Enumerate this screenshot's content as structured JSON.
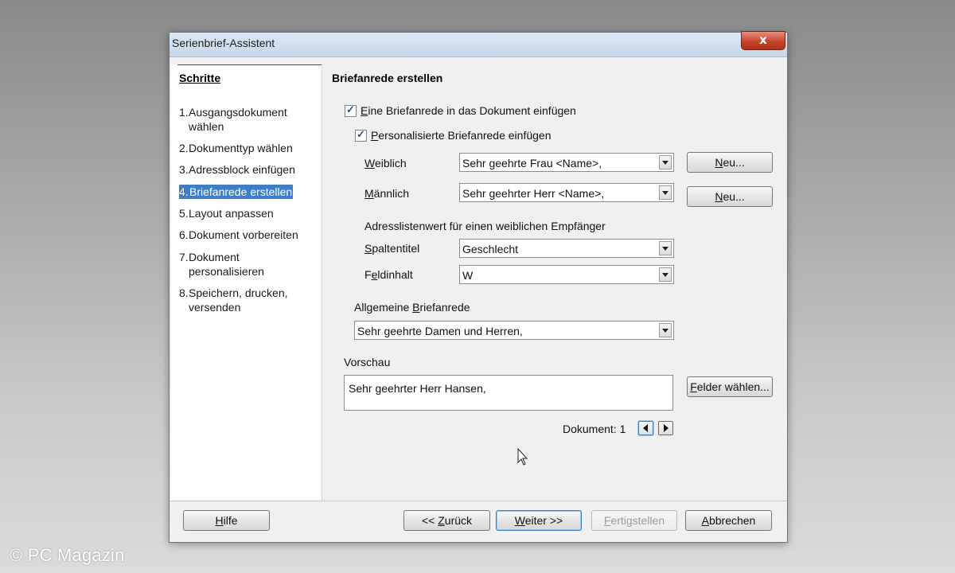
{
  "watermark": "© PC Magazin",
  "window": {
    "title": "Serienbrief-Assistent",
    "close_glyph": "x"
  },
  "steps": {
    "heading": "Schritte",
    "items": [
      {
        "num": "1.",
        "line1": "Ausgangsdokument",
        "line2": "wählen"
      },
      {
        "num": "2.",
        "line1": "Dokumenttyp wählen",
        "line2": ""
      },
      {
        "num": "3.",
        "line1": "Adressblock einfügen",
        "line2": ""
      },
      {
        "num": "4.",
        "line1": "Briefanrede erstellen",
        "line2": ""
      },
      {
        "num": "5.",
        "line1": "Layout anpassen",
        "line2": ""
      },
      {
        "num": "6.",
        "line1": "Dokument vorbereiten",
        "line2": ""
      },
      {
        "num": "7.",
        "line1": "Dokument",
        "line2": "personalisieren"
      },
      {
        "num": "8.",
        "line1": "Speichern, drucken,",
        "line2": "versenden"
      }
    ],
    "active_index": 3
  },
  "main": {
    "title": "Briefanrede erstellen",
    "insert_salutation": {
      "label_first": "E",
      "label_rest": "ine Briefanrede in das Dokument einfügen",
      "checked": true
    },
    "personalized": {
      "label_first": "P",
      "label_rest": "ersonalisierte Briefanrede einfügen",
      "checked": true
    },
    "female": {
      "label_first": "W",
      "label_rest": "eiblich",
      "value": "Sehr geehrte Frau <Name>,"
    },
    "male": {
      "label_first": "M",
      "label_rest": "ännlich",
      "value": "Sehr geehrter Herr <Name>,"
    },
    "new_button_1": {
      "first": "N",
      "rest": "eu..."
    },
    "new_button_2": {
      "first": "N",
      "rest": "eu..."
    },
    "address_list_caption": "Adresslistenwert für einen weiblichen Empfänger",
    "column_title": {
      "label_first": "S",
      "label_rest": "paltentitel",
      "value": "Geschlecht"
    },
    "field_content": {
      "label_pre": "F",
      "label_u": "e",
      "label_rest": "ldinhalt",
      "value": "W"
    },
    "general": {
      "label_pre": "Allgemeine ",
      "label_u": "B",
      "label_rest": "riefanrede",
      "value": "Sehr geehrte Damen und Herren,"
    },
    "preview": {
      "label": "Vorschau",
      "value": "Sehr geehrter Herr Hansen,"
    },
    "select_fields_button": {
      "first": "F",
      "rest": "elder wählen..."
    },
    "document_nav": {
      "label": "Dokument: 1"
    }
  },
  "footer": {
    "help": {
      "first": "H",
      "rest": "ilfe"
    },
    "back": {
      "pre": "<< ",
      "first": "Z",
      "rest": "urück"
    },
    "next": {
      "first": "W",
      "rest": "eiter >>"
    },
    "finish": {
      "first": "F",
      "rest": "ertigstellen"
    },
    "cancel": {
      "first": "A",
      "rest": "bbrechen"
    }
  },
  "icons": {
    "cursor": "mouse-pointer-icon",
    "prev": "triangle-left-icon",
    "next": "triangle-right-icon"
  }
}
